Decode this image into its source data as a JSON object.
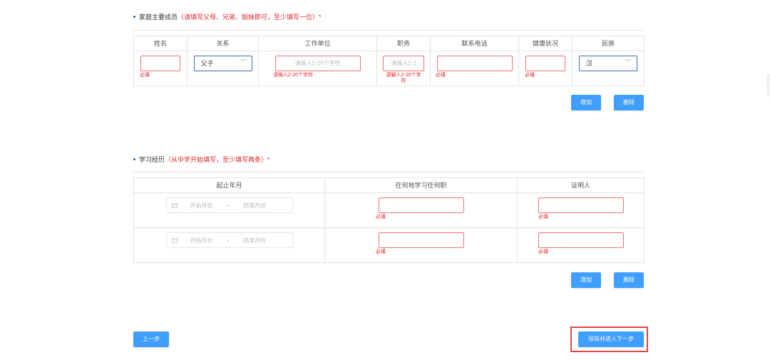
{
  "family": {
    "title": "家庭主要成员",
    "note": "（请填写父母、兄弟、姐妹即可，至少填写一位）*",
    "headers": [
      "姓名",
      "关系",
      "工作单位",
      "职务",
      "联系电话",
      "健康状况",
      "民族"
    ],
    "row": {
      "relation": "父子",
      "work_placeholder": "请输入2-20个字符",
      "duty_placeholder": "请输入2-2",
      "required": "必填",
      "work_hint": "请输入2-20个字符",
      "duty_hint": "请输入2-20个字符",
      "ethnicity": "汉"
    },
    "add_label": "增加",
    "delete_label": "删除"
  },
  "study": {
    "title": "学习经历",
    "note": "（从中学开始填写，至少填写两条）*",
    "headers": [
      "起止年月",
      "在何地学习任何职",
      "证明人"
    ],
    "rows": [
      {
        "start_placeholder": "开始月份",
        "sep": "-",
        "end_placeholder": "结束月份",
        "required": "必填"
      },
      {
        "start_placeholder": "开始月份",
        "sep": "-",
        "end_placeholder": "结束月份",
        "required": "必填"
      }
    ],
    "add_label": "增加",
    "delete_label": "删除"
  },
  "footer": {
    "prev_label": "上一步",
    "save_label": "保存并进入下一步"
  },
  "colors": {
    "primary": "#409eff",
    "error": "#e02424",
    "highlight": "#e04646"
  }
}
